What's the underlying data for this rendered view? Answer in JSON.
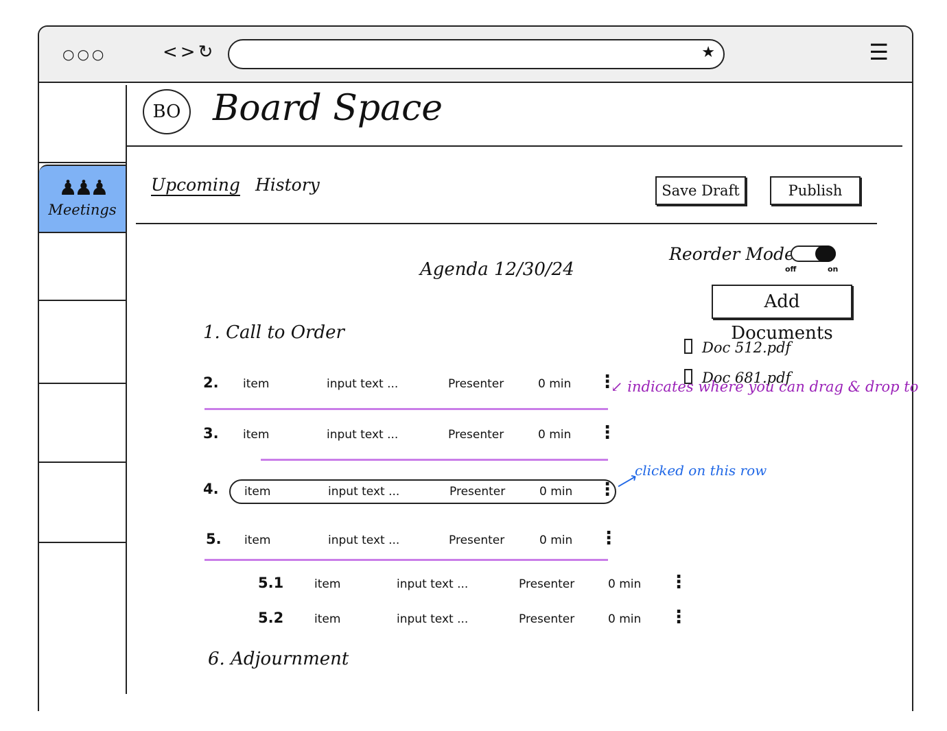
{
  "browser": {
    "dots": "○○○",
    "nav": "<>↻",
    "star": "★",
    "menu": "☰"
  },
  "sidebar": {
    "active_item": {
      "icon": "people-icon",
      "label": "Meetings"
    }
  },
  "header": {
    "logo_text": "BO",
    "title": "Board Space"
  },
  "tabs": {
    "upcoming": "Upcoming",
    "history": "History"
  },
  "toolbar": {
    "save_draft": "Save Draft",
    "publish": "Publish"
  },
  "agenda": {
    "title": "Agenda 12/30/24",
    "call_to_order": "1. Call to Order",
    "adjournment": "6. Adjournment",
    "rows": [
      {
        "num": "2.",
        "item": "item",
        "text": "input text ...",
        "presenter": "Presenter",
        "duration": "0 min"
      },
      {
        "num": "3.",
        "item": "item",
        "text": "input text ...",
        "presenter": "Presenter",
        "duration": "0 min"
      },
      {
        "num": "4.",
        "item": "item",
        "text": "input text ...",
        "presenter": "Presenter",
        "duration": "0 min"
      },
      {
        "num": "5.",
        "item": "item",
        "text": "input text ...",
        "presenter": "Presenter",
        "duration": "0 min"
      },
      {
        "num": "5.1",
        "item": "item",
        "text": "input text ...",
        "presenter": "Presenter",
        "duration": "0 min"
      },
      {
        "num": "5.2",
        "item": "item",
        "text": "input text ...",
        "presenter": "Presenter",
        "duration": "0 min"
      }
    ]
  },
  "reorder": {
    "label": "Reorder Mode",
    "off": "off",
    "on": "on",
    "state": "on"
  },
  "documents": {
    "add_button": "Add Documents",
    "files": [
      "Doc 512.pdf",
      "Doc 681.pdf"
    ]
  },
  "annotations": {
    "drag_drop": "↙ indicates where you can drag & drop to",
    "clicked": "clicked on this row",
    "drag_color": "#c97de8",
    "click_color": "#1f67e6"
  },
  "colors": {
    "sidebar_active": "#7fb2f5",
    "chrome_bg": "#efefef"
  }
}
